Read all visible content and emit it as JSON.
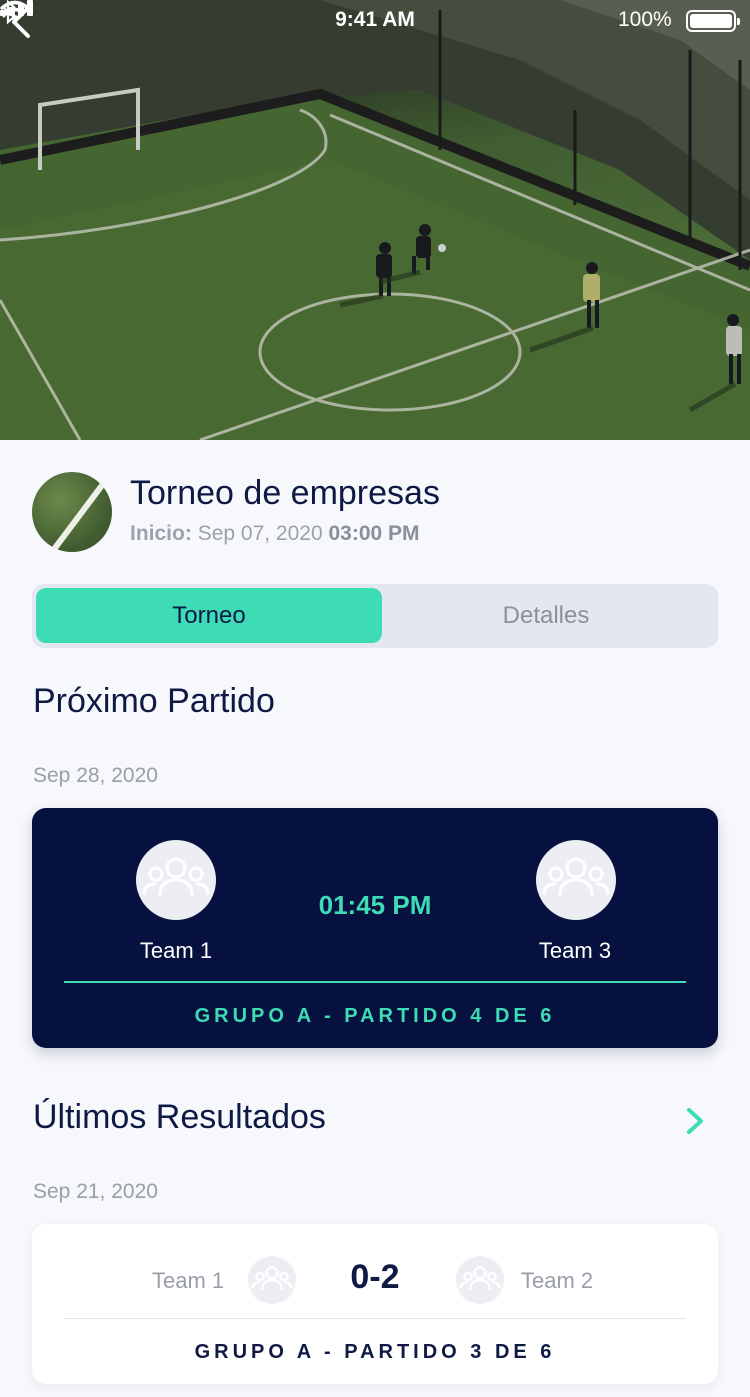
{
  "status_bar": {
    "time": "9:41 AM",
    "battery": "100%",
    "battery_level": 1.0
  },
  "tournament": {
    "title": "Torneo de empresas",
    "start_label": "Inicio:",
    "start_date": "Sep 07, 2020",
    "start_time": "03:00 PM"
  },
  "tabs": {
    "active": "Torneo",
    "inactive": "Detalles"
  },
  "next_match": {
    "section_title": "Próximo Partido",
    "date": "Sep 28, 2020",
    "home_team": "Team 1",
    "away_team": "Team 3",
    "time": "01:45 PM",
    "group_label": "GRUPO A - PARTIDO 4 DE 6"
  },
  "last_results": {
    "section_title": "Últimos Resultados",
    "date": "Sep 21, 2020",
    "home_team": "Team 1",
    "away_team": "Team 2",
    "score": "0-2",
    "group_label": "GRUPO A - PARTIDO 3 DE 6"
  },
  "icons": {
    "back": "chevron-left-icon",
    "more": "chevron-right-icon",
    "team": "group-icon"
  },
  "colors": {
    "accent": "#3ddcb4",
    "navy": "#07113f",
    "text_dark": "#0e1a44",
    "text_muted": "#9a9ea9",
    "background": "#f7f8fc"
  }
}
